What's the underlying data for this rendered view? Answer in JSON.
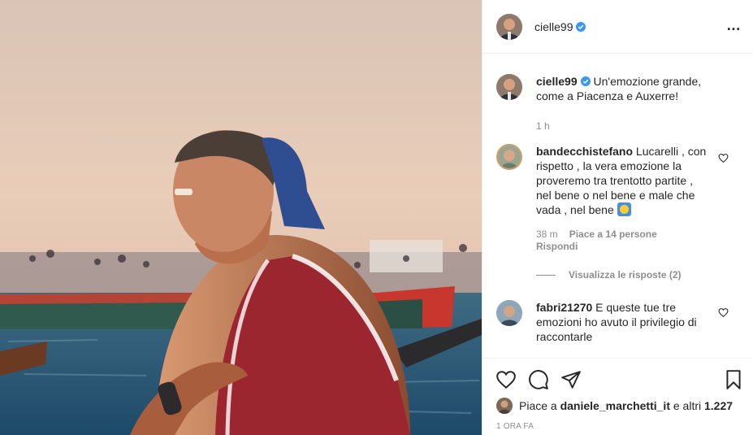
{
  "post": {
    "author": "cielle99",
    "caption": "Un'emozione grande, come a Piacenza e Auxerre!",
    "caption_time": "1 h",
    "verified_icon": "verified-badge-icon",
    "accent": "#3897f0"
  },
  "comments": [
    {
      "user": "bandecchistefano",
      "text": "Lucarelli , con rispetto , la vera emozione la proveremo tra trentotto partite , nel bene o nel bene e male che vada , nel bene",
      "time": "38 m",
      "likes": "Piace a 14 persone",
      "reply": "Rispondi",
      "view_replies": "Visualizza le risposte (2)"
    },
    {
      "user": "fabri21270",
      "text": "E queste tue tre emozioni ho avuto il privilegio di raccontarle"
    }
  ],
  "actions": {
    "liked_by_prefix": "Piace a",
    "liked_by_user": "daniele_marchetti_it",
    "liked_by_suffix": "e altri",
    "like_count": "1.227",
    "posted_time": "1 ORA FA"
  }
}
